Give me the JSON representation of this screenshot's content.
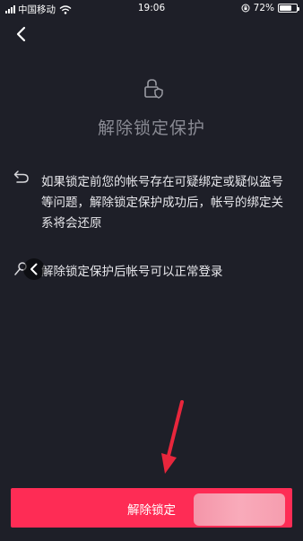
{
  "status_bar": {
    "carrier": "中国移动",
    "time": "19:06",
    "battery_percent_label": "72%",
    "battery_level": 0.72,
    "signal_bars": 4,
    "icons": [
      "signal-icon",
      "wifi-icon",
      "orientation-lock-icon",
      "battery-icon"
    ]
  },
  "header": {
    "back_icon": "chevron-left-icon"
  },
  "hero": {
    "icon": "lock-shield-icon",
    "title": "解除锁定保护"
  },
  "info_items": [
    {
      "icon": "undo-arrow-icon",
      "text": "如果锁定前您的帐号存在可疑绑定或疑似盗号等问题，解除锁定保护成功后，帐号的绑定关系将会还原"
    },
    {
      "icon": "user-key-icon",
      "text": "解除锁定保护后帐号可以正常登录"
    }
  ],
  "actions": {
    "unlock_label": "解除锁定"
  },
  "colors": {
    "background": "#1e1f28",
    "primary": "#fe2c55",
    "title_text": "#8a8b94",
    "body_text": "#e8e8ec"
  }
}
